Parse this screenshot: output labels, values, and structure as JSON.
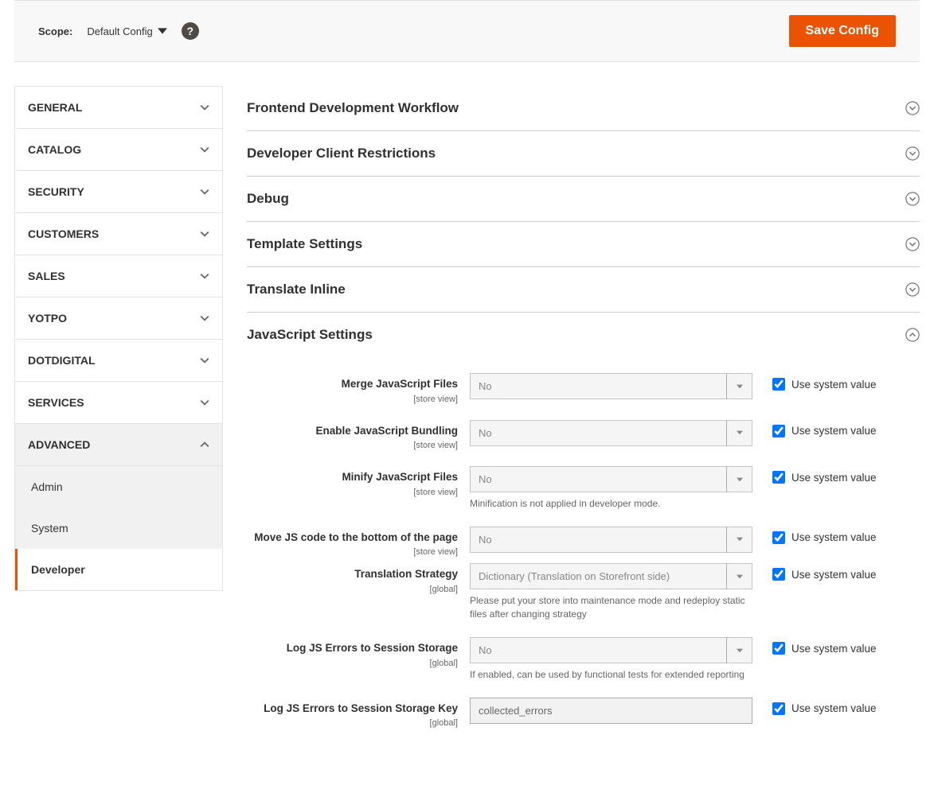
{
  "header": {
    "scope_label": "Scope:",
    "scope_value": "Default Config",
    "save_btn": "Save Config"
  },
  "sidebar": {
    "items": [
      {
        "label": "GENERAL",
        "expanded": false
      },
      {
        "label": "CATALOG",
        "expanded": false
      },
      {
        "label": "SECURITY",
        "expanded": false
      },
      {
        "label": "CUSTOMERS",
        "expanded": false
      },
      {
        "label": "SALES",
        "expanded": false
      },
      {
        "label": "YOTPO",
        "expanded": false
      },
      {
        "label": "DOTDIGITAL",
        "expanded": false
      },
      {
        "label": "SERVICES",
        "expanded": false
      },
      {
        "label": "ADVANCED",
        "expanded": true
      }
    ],
    "sub": [
      {
        "label": "Admin",
        "active": false
      },
      {
        "label": "System",
        "active": false
      },
      {
        "label": "Developer",
        "active": true
      }
    ]
  },
  "sections": {
    "s0": "Frontend Development Workflow",
    "s1": "Developer Client Restrictions",
    "s2": "Debug",
    "s3": "Template Settings",
    "s4": "Translate Inline",
    "s5": "JavaScript Settings"
  },
  "fields": {
    "merge_js": {
      "label": "Merge JavaScript Files",
      "scope": "[store view]",
      "value": "No"
    },
    "bundle_js": {
      "label": "Enable JavaScript Bundling",
      "scope": "[store view]",
      "value": "No"
    },
    "minify_js": {
      "label": "Minify JavaScript Files",
      "scope": "[store view]",
      "value": "No",
      "note": "Minification is not applied in developer mode."
    },
    "move_js": {
      "label": "Move JS code to the bottom of the page",
      "scope": "[store view]",
      "value": "No"
    },
    "trans_strategy": {
      "label": "Translation Strategy",
      "scope": "[global]",
      "value": "Dictionary (Translation on Storefront side)",
      "note": "Please put your store into maintenance mode and redeploy static files after changing strategy"
    },
    "log_js": {
      "label": "Log JS Errors to Session Storage",
      "scope": "[global]",
      "value": "No",
      "note": "If enabled, can be used by functional tests for extended reporting"
    },
    "log_js_key": {
      "label": "Log JS Errors to Session Storage Key",
      "scope": "[global]",
      "value": "collected_errors"
    }
  },
  "use_system": "Use system value"
}
